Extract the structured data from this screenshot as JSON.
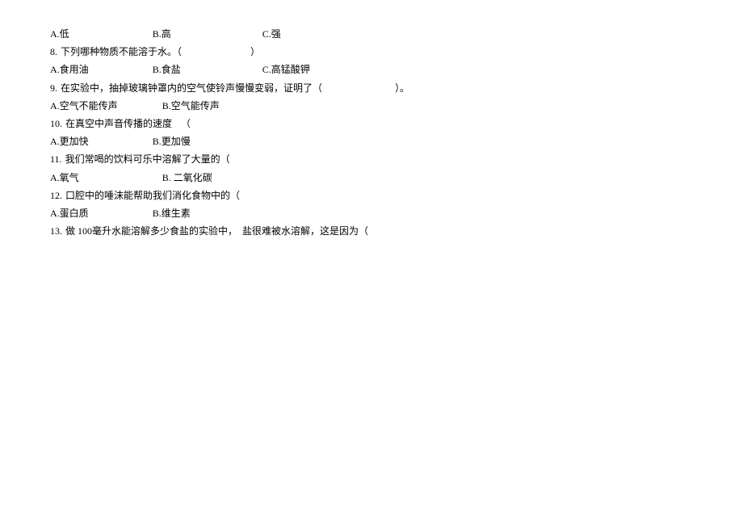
{
  "q7": {
    "optA_label": "A.",
    "optA_text": "低",
    "optB_label": "B.",
    "optB_text": "高",
    "optC_label": "C.",
    "optC_text": "强"
  },
  "q8": {
    "num": "8.",
    "stem": "下列哪种物质不能溶于水。（",
    "stem_close": "）",
    "optA_label": "A.",
    "optA_text": "食用油",
    "optB_label": "B.",
    "optB_text": "食盐",
    "optC_label": "C.",
    "optC_text": "高锰酸钾"
  },
  "q9": {
    "num": "9.",
    "stem": "在实验中，抽掉玻璃钟罩内的空气使铃声慢慢变弱，证明了（",
    "stem_close": "）。",
    "optA_label": "A.",
    "optA_text": "空气不能传声",
    "optB_label": "B.",
    "optB_text": "空气能传声"
  },
  "q10": {
    "num": "10.",
    "stem": "在真空中声音传播的速度",
    "paren": "（",
    "optA_label": "A.",
    "optA_text": "更加快",
    "optB_label": "B.",
    "optB_text": "更加慢"
  },
  "q11": {
    "num": "11.",
    "stem": "我们常喝的饮料可乐中溶解了大量的（",
    "optA_label": "A.",
    "optA_text": "氧气",
    "optB_label": "B.",
    "optB_text": "二氧化碳"
  },
  "q12": {
    "num": "12.",
    "stem": "口腔中的唾沫能帮助我们消化食物中的（",
    "optA_label": "A.",
    "optA_text": "蛋白质",
    "optB_label": "B.",
    "optB_text": "维生素"
  },
  "q13": {
    "num": "13.",
    "stem_a": "做 100毫升水能溶解多少食盐的实验中，",
    "stem_b": "盐很难被水溶解，这是因为（"
  }
}
